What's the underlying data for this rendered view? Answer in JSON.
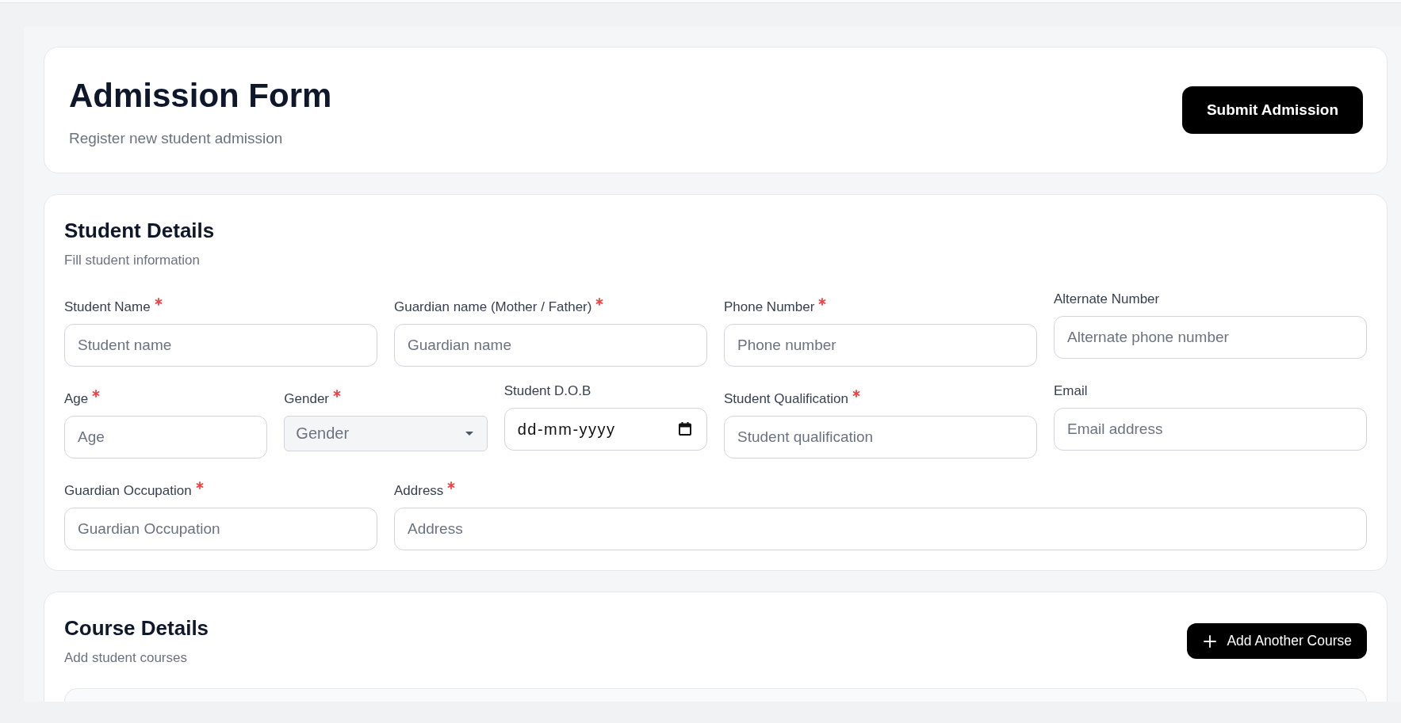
{
  "header": {
    "title": "Admission Form",
    "subtitle": "Register new student admission",
    "submit_button": "Submit Admission"
  },
  "student_details": {
    "title": "Student Details",
    "subtitle": "Fill student information",
    "fields": [
      {
        "label": "Student Name",
        "required": true,
        "kind": "text",
        "placeholder": "Student name"
      },
      {
        "label": "Guardian name (Mother / Father)",
        "required": true,
        "kind": "text",
        "placeholder": "Guardian name"
      },
      {
        "label": "Phone Number",
        "required": true,
        "kind": "text",
        "placeholder": "Phone number"
      },
      {
        "label": "Alternate Number",
        "required": false,
        "kind": "text",
        "placeholder": "Alternate phone number"
      },
      {
        "label": "Age",
        "required": true,
        "kind": "text",
        "placeholder": "Age"
      },
      {
        "label": "Gender",
        "required": true,
        "kind": "select",
        "placeholder": "Gender"
      },
      {
        "label": "Student D.O.B",
        "required": false,
        "kind": "date",
        "placeholder": "dd-mm-yyyy"
      },
      {
        "label": "Student Qualification",
        "required": true,
        "kind": "text",
        "placeholder": "Student qualification"
      },
      {
        "label": "Email",
        "required": false,
        "kind": "text",
        "placeholder": "Email address"
      },
      {
        "label": "Guardian Occupation",
        "required": true,
        "kind": "text",
        "placeholder": "Guardian Occupation"
      },
      {
        "label": "Address",
        "required": true,
        "kind": "text",
        "placeholder": "Address"
      }
    ]
  },
  "course_details": {
    "title": "Course Details",
    "subtitle": "Add student courses",
    "add_button": "Add Another Course"
  }
}
